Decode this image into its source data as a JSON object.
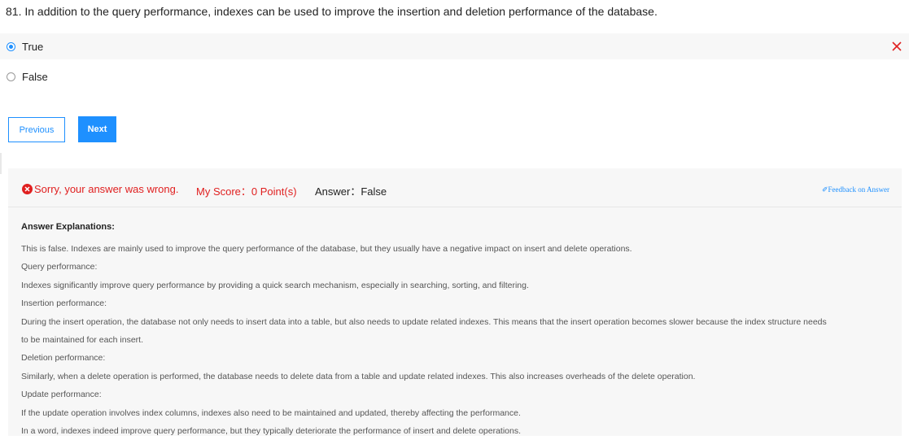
{
  "question": {
    "text": "81. In addition to the query performance, indexes can be used to improve the insertion and deletion performance of the database."
  },
  "options": [
    {
      "label": "True",
      "selected": true,
      "wrong": true
    },
    {
      "label": "False",
      "selected": false,
      "wrong": false
    }
  ],
  "nav": {
    "previous_label": "Previous",
    "next_label": "Next"
  },
  "result": {
    "status_text": "Sorry, your answer was wrong.",
    "score_text": "My Score：0 Point(s)",
    "answer_text": "Answer：False",
    "feedback_label": "✐Feedback on Answer",
    "colors": {
      "wrong": "#e02020",
      "accent": "#1e90ff"
    }
  },
  "explanation": {
    "title": "Answer Explanations:",
    "lines": [
      "This is false. Indexes are mainly used to improve the query performance of the database, but they usually have a negative impact on insert and delete operations.",
      "Query performance:",
      "Indexes significantly improve query performance by providing a quick search mechanism, especially in searching, sorting, and filtering.",
      "Insertion performance:",
      "During the insert operation, the database not only needs to insert data into a table, but also needs to update related indexes. This means that the insert operation becomes slower because the index structure needs",
      "to be maintained for each insert.",
      "Deletion performance:",
      "Similarly, when a delete operation is performed, the database needs to delete data from a table and update related indexes. This also increases overheads of the delete operation.",
      "Update performance:",
      "If the update operation involves index columns, indexes also need to be maintained and updated, thereby affecting the performance.",
      "In a word, indexes indeed improve query performance, but they typically deteriorate the performance of insert and delete operations."
    ]
  }
}
